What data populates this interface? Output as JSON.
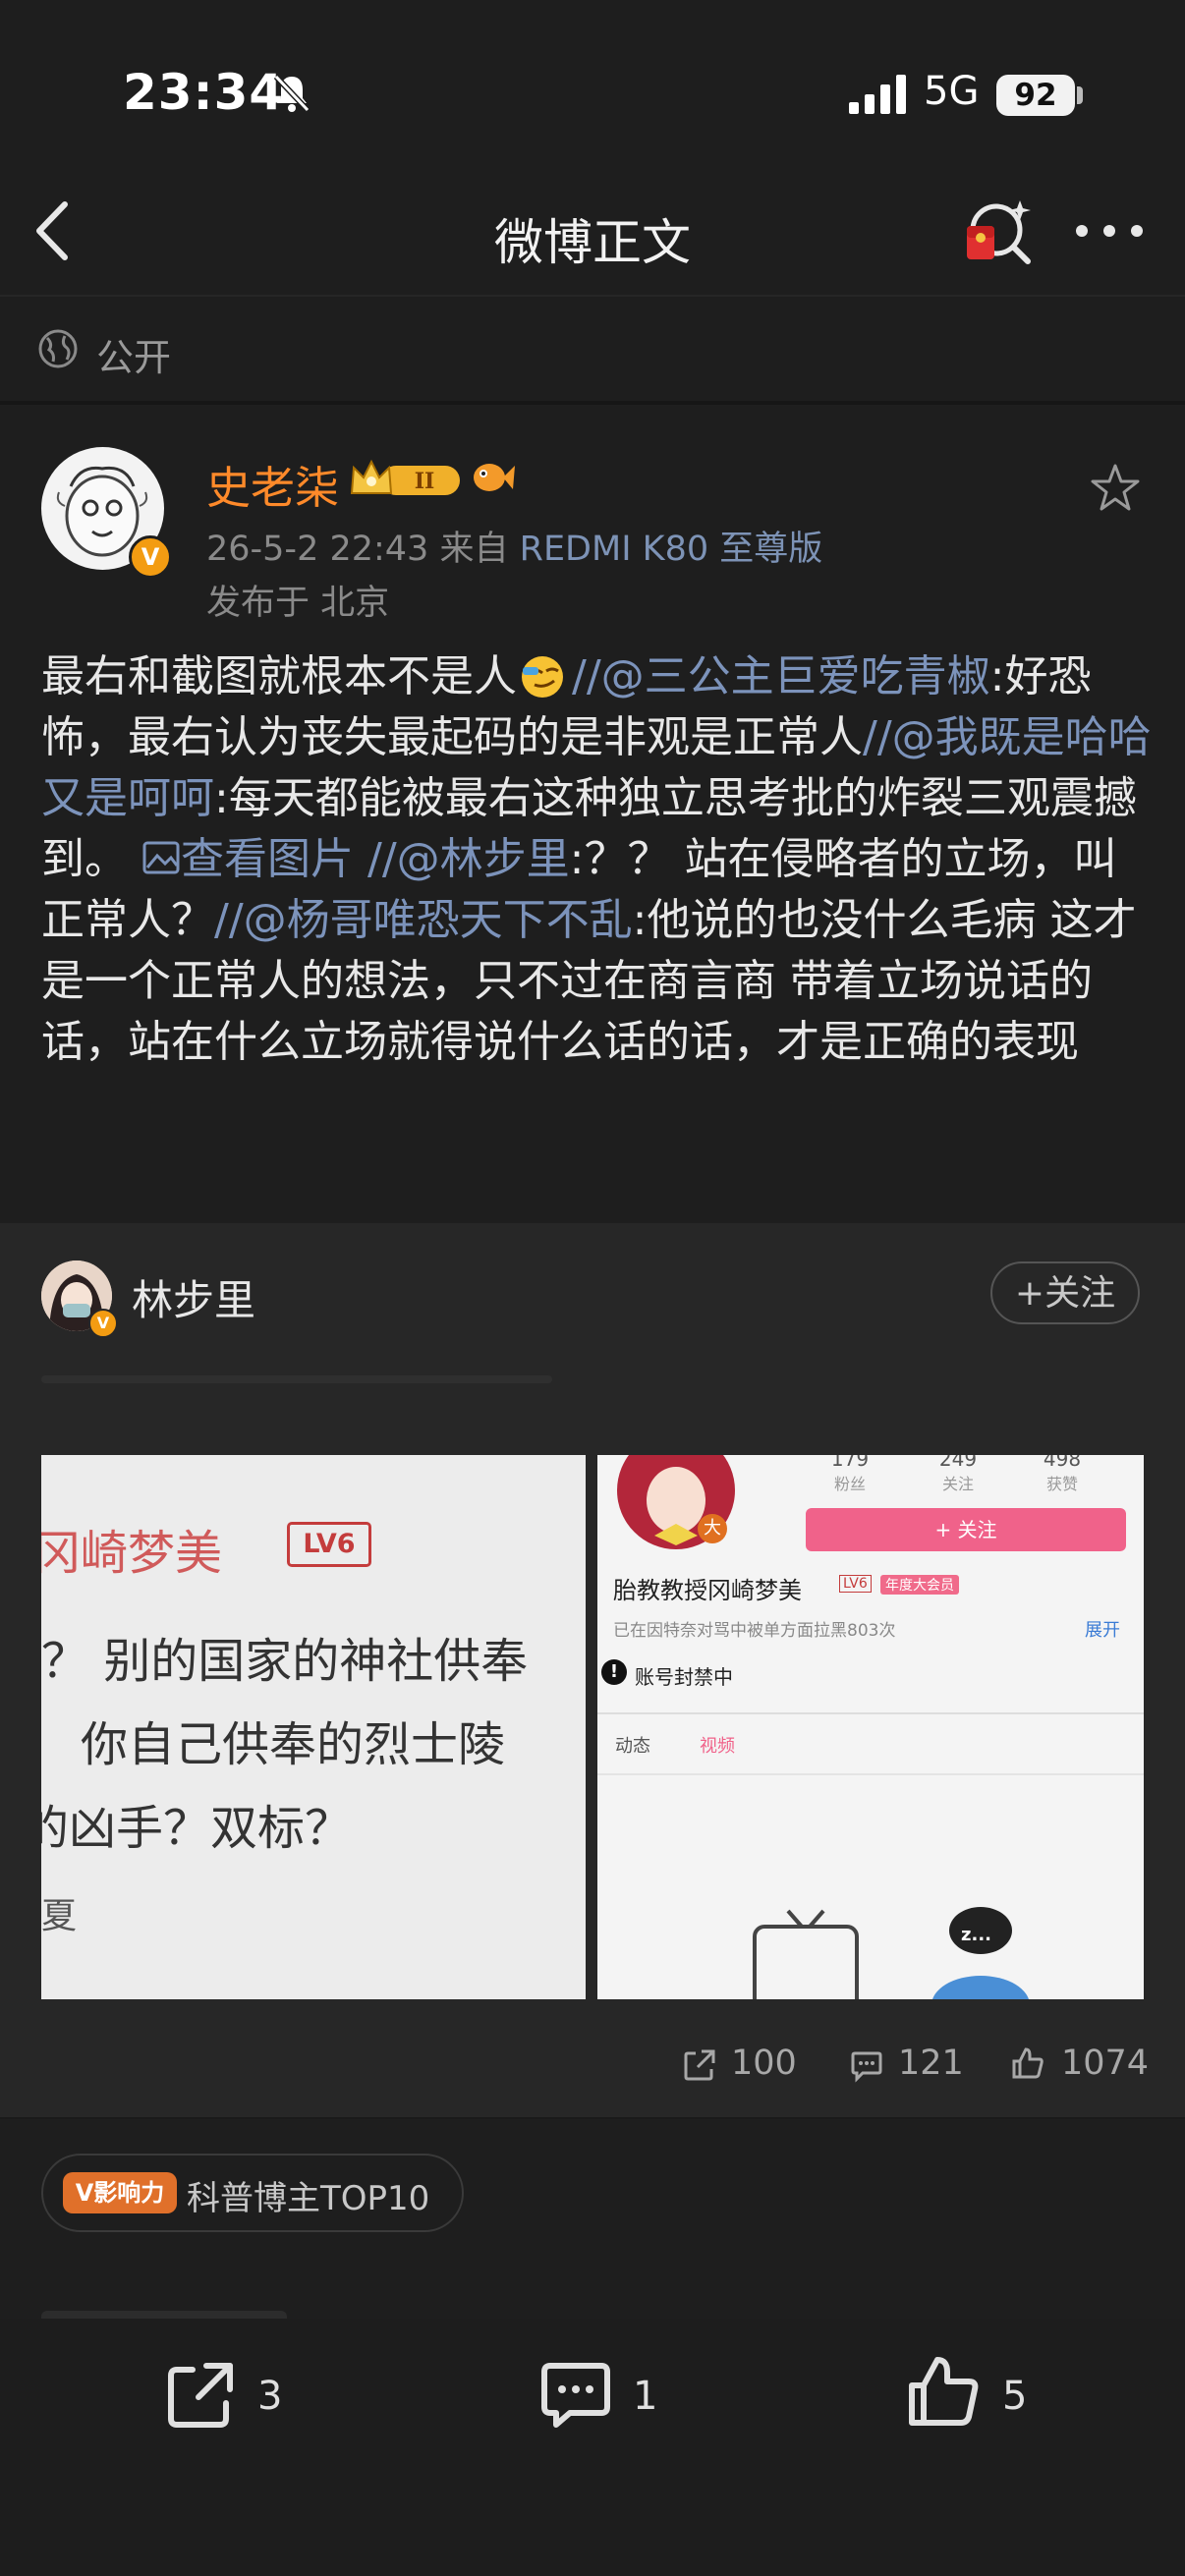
{
  "status_bar": {
    "time": "23:34",
    "network": "5G",
    "battery": "92"
  },
  "nav": {
    "title": "微博正文"
  },
  "visibility": {
    "label": "公开"
  },
  "post": {
    "author": "史老柒",
    "timestamp": "26-5-2 22:43",
    "source_prefix": "来自",
    "device": "REDMI K80 至尊版",
    "location": "发布于 北京",
    "v_badge": "V",
    "body": {
      "p1": "最右和截图就根本不是人",
      "m1": "//@三公主巨爱吃青椒",
      "p2": ":好恐怖，最右认为丧失最起码的是非观是正常人",
      "m2": "//@我既是哈哈又是呵呵",
      "p3": ":每天都能被最右这种独立思考批的炸裂三观震撼到。",
      "pic": "查看图片",
      "m3": "//@林步里",
      "p4": ":？？ 站在侵略者的立场，叫正常人？",
      "m4": "//@杨哥唯恐天下不乱",
      "p5": ":他说的也没什么毛病   这才是一个正常人的想法，只不过在商言商 带着立场说话的话，站在什么立场就得说什么话的话，才是正确的表现"
    }
  },
  "quoted": {
    "author": "林步里",
    "follow_label": "+关注",
    "image1": {
      "line1": "冈崎梦美",
      "level": "LV6",
      "line2": "？ 别的国家的神社供奉",
      "line3": "你自己供奉的烈士陵",
      "line4": "的凶手？双标？",
      "line5": "夏"
    },
    "image2": {
      "stats": [
        {
          "num": "179",
          "label": "粉丝"
        },
        {
          "num": "249",
          "label": "关注"
        },
        {
          "num": "498",
          "label": "获赞"
        }
      ],
      "follow": "+ 关注",
      "name": "胎教教授冈崎梦美",
      "level": "LV6",
      "member": "年度大会员",
      "desc": "已在因特奈对骂中被单方面拉黑803次",
      "expand": "展开",
      "banned": "账号封禁中",
      "tab1": "动态",
      "tab2": "视频",
      "bubble": "z..."
    },
    "reposts": "100",
    "comments": "121",
    "likes": "1074"
  },
  "influence": {
    "tag": "V影响力",
    "label": "科普博主TOP10"
  },
  "bottom_bar": {
    "reposts": "3",
    "comments": "1",
    "likes": "5"
  }
}
